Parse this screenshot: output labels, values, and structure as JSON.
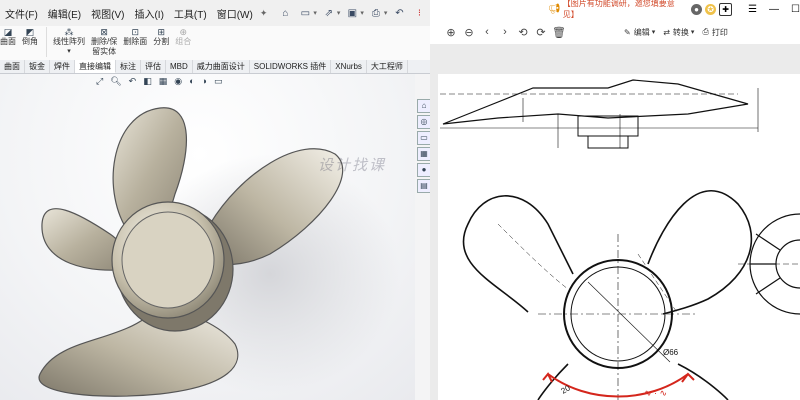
{
  "solidworks": {
    "menu": [
      "文件(F)",
      "编辑(E)",
      "视图(V)",
      "插入(I)",
      "工具(T)",
      "窗口(W)"
    ],
    "ribbon": [
      {
        "label": "曲面",
        "sub": ""
      },
      {
        "label": "倒角",
        "sub": ""
      },
      {
        "label": "线性阵列",
        "sub": ""
      },
      {
        "label": "删除/保",
        "sub": "留实体"
      },
      {
        "label": "删除面",
        "sub": ""
      },
      {
        "label": "分割",
        "sub": ""
      },
      {
        "label": "组合",
        "sub": ""
      }
    ],
    "tabs": [
      "曲面",
      "钣金",
      "焊件",
      "直接编辑",
      "标注",
      "评估",
      "MBD",
      "威力曲面设计",
      "SOLIDWORKS 插件",
      "XNurbs",
      "大工程师"
    ],
    "active_tab": "直接编辑",
    "watermark": "设计找课"
  },
  "pdf": {
    "ad_text": "【图片有功能调研，邀您填要意见】",
    "tools": {
      "edit": "编辑",
      "convert": "转换",
      "print": "打印"
    },
    "dim_label_1": "Ø66",
    "dim_label_2": "20"
  }
}
